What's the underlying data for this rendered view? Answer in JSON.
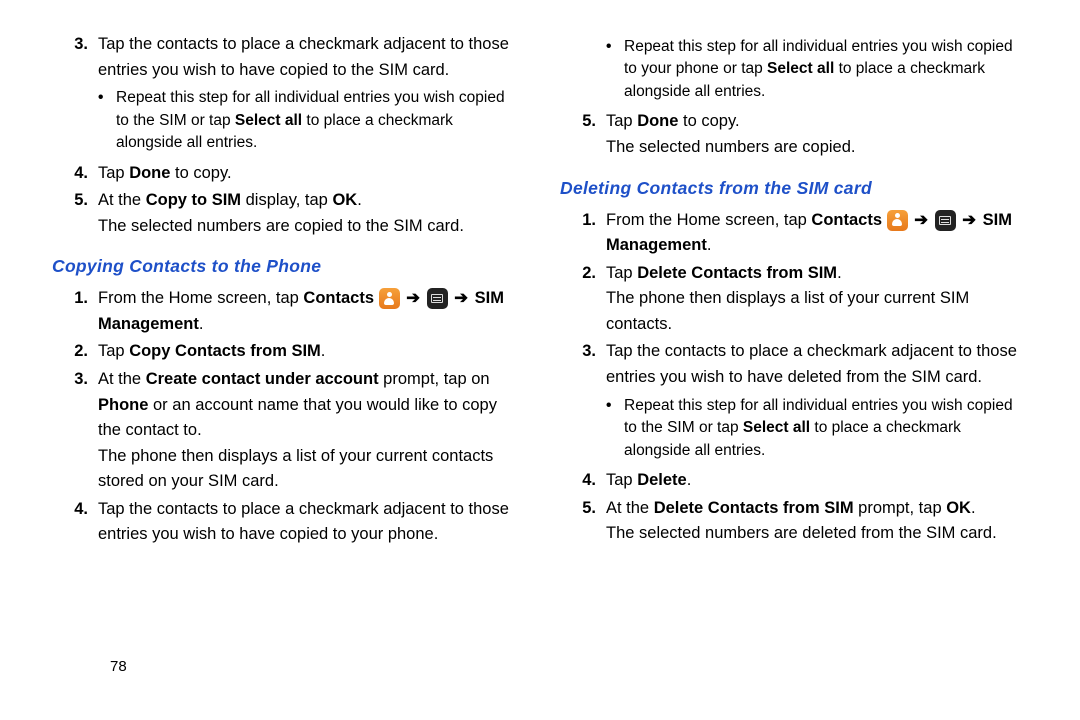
{
  "page_number": "78",
  "left": {
    "items": [
      {
        "num": "3.",
        "text": "Tap the contacts to place a checkmark adjacent to those entries you wish to have copied to the SIM card.",
        "sub": [
          "Repeat this step for all individual entries you wish copied to the SIM or tap <b>Select all</b> to place a checkmark alongside all entries."
        ]
      },
      {
        "num": "4.",
        "text": "Tap <b>Done</b> to copy."
      },
      {
        "num": "5.",
        "text": "At the <b>Copy to SIM</b> display, tap <b>OK</b>.<br>The selected numbers are copied to the SIM card."
      }
    ],
    "section_heading": "Copying Contacts to the Phone",
    "section_items": [
      {
        "num": "1.",
        "html": "From the Home screen, tap <b>Contacts</b> {contacts-icon} {arrow} {menu-icon} {arrow} <b>SIM Management</b>."
      },
      {
        "num": "2.",
        "text": "Tap <b>Copy Contacts from SIM</b>."
      },
      {
        "num": "3.",
        "text": "At the <b>Create contact under account</b> prompt, tap on <b>Phone</b> or an account name that you would like to copy the contact to.<br>The phone then displays a list of your current contacts stored on your SIM card."
      },
      {
        "num": "4.",
        "text": "Tap the contacts to place a checkmark adjacent to those entries you wish to have copied to your phone."
      }
    ]
  },
  "right": {
    "items": [
      {
        "num": "",
        "sub": [
          "Repeat this step for all individual entries you wish copied to your phone or tap <b>Select all</b> to place a checkmark alongside all entries."
        ]
      },
      {
        "num": "5.",
        "text": "Tap <b>Done</b> to copy.<br>The selected numbers are copied."
      }
    ],
    "section_heading": "Deleting Contacts from the SIM card",
    "section_items": [
      {
        "num": "1.",
        "html": "From the Home screen, tap <b>Contacts</b> {contacts-icon} {arrow} {menu-icon} {arrow} <b>SIM Management</b>."
      },
      {
        "num": "2.",
        "text": "Tap <b>Delete Contacts from SIM</b>.<br>The phone then displays a list of your current SIM contacts."
      },
      {
        "num": "3.",
        "text": "Tap the contacts to place a checkmark adjacent to those entries you wish to have deleted from the SIM card.",
        "sub": [
          "Repeat this step for all individual entries you wish copied to the SIM or tap <b>Select all</b> to place a checkmark alongside all entries."
        ]
      },
      {
        "num": "4.",
        "text": "Tap <b>Delete</b>."
      },
      {
        "num": "5.",
        "text": "At the <b>Delete Contacts from SIM</b> prompt, tap <b>OK</b>.<br>The selected numbers are deleted from the SIM card."
      }
    ]
  }
}
